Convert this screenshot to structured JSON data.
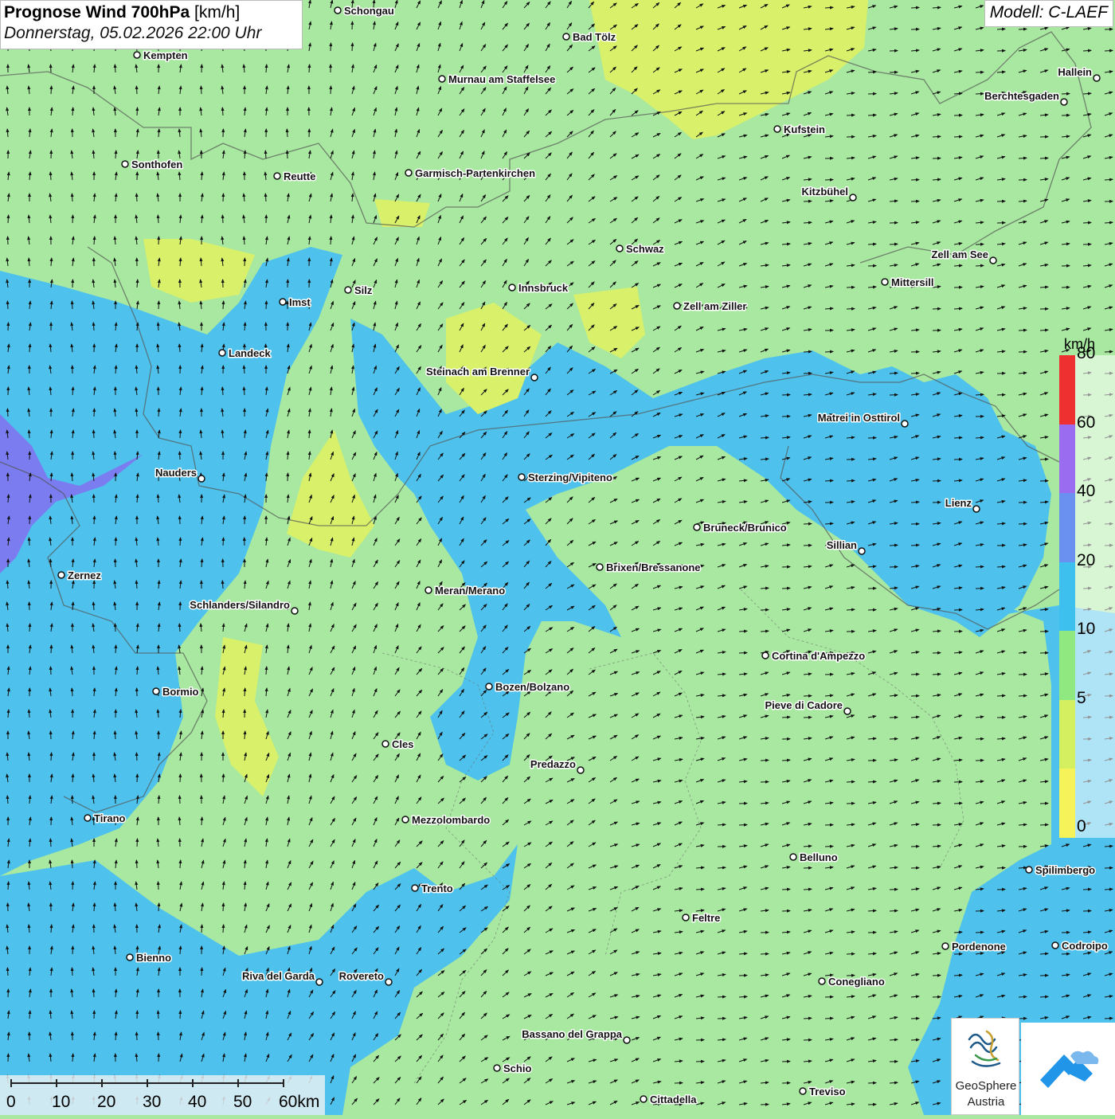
{
  "header": {
    "title_bold": "Prognose Wind 700hPa",
    "title_unit": "[km/h]",
    "datetime": "Donnerstag, 05.02.2026 22:00 Uhr",
    "model": "Modell: C-LAEF"
  },
  "legend": {
    "unit": "km/h",
    "classes": [
      {
        "label": "0",
        "color": "#f5f25a"
      },
      {
        "label": "5",
        "color": "#d4f060"
      },
      {
        "label": "10",
        "color": "#90e880"
      },
      {
        "label": "20",
        "color": "#3ec0ee"
      },
      {
        "label": "40",
        "color": "#6a90f0"
      },
      {
        "label": "60",
        "color": "#9a6cf0"
      },
      {
        "label": "80",
        "color": "#ee3030"
      }
    ]
  },
  "scale_bar": {
    "labels": [
      "0",
      "10",
      "20",
      "30",
      "40",
      "50",
      "60km"
    ]
  },
  "logos": {
    "geosphere_line1": "GeoSphere",
    "geosphere_line2": "Austria"
  },
  "cities": [
    {
      "name": "Schongau"
    },
    {
      "name": "Bad Tölz"
    },
    {
      "name": "Kempten"
    },
    {
      "name": "Murnau am Staffelsee"
    },
    {
      "name": "Hallein"
    },
    {
      "name": "Berchtesgaden"
    },
    {
      "name": "Kufstein"
    },
    {
      "name": "Sonthofen"
    },
    {
      "name": "Reutte"
    },
    {
      "name": "Garmisch-Partenkirchen"
    },
    {
      "name": "Kitzbühel"
    },
    {
      "name": "Schwaz"
    },
    {
      "name": "Zell am See"
    },
    {
      "name": "Mittersill"
    },
    {
      "name": "Innsbruck"
    },
    {
      "name": "Zell am Ziller"
    },
    {
      "name": "Silz"
    },
    {
      "name": "Imst"
    },
    {
      "name": "Landeck"
    },
    {
      "name": "Steinach am Brenner"
    },
    {
      "name": "Matrei in Osttirol"
    },
    {
      "name": "Nauders"
    },
    {
      "name": "Sterzing/Vipiteno"
    },
    {
      "name": "Lienz"
    },
    {
      "name": "Bruneck/Brunico"
    },
    {
      "name": "Sillian"
    },
    {
      "name": "Zernez"
    },
    {
      "name": "Brixen/Bressanone"
    },
    {
      "name": "Meran/Merano"
    },
    {
      "name": "Schlanders/Silandro"
    },
    {
      "name": "Cortina d'Ampezzo"
    },
    {
      "name": "Bormio"
    },
    {
      "name": "Bozen/Bolzano"
    },
    {
      "name": "Pieve di Cadore"
    },
    {
      "name": "Cles"
    },
    {
      "name": "Predazzo"
    },
    {
      "name": "Tirano"
    },
    {
      "name": "Mezzolombardo"
    },
    {
      "name": "Belluno"
    },
    {
      "name": "Spilimbergo"
    },
    {
      "name": "Trento"
    },
    {
      "name": "Feltre"
    },
    {
      "name": "Pordenone"
    },
    {
      "name": "Codroipo"
    },
    {
      "name": "Bienno"
    },
    {
      "name": "Riva del Garda"
    },
    {
      "name": "Rovereto"
    },
    {
      "name": "Conegliano"
    },
    {
      "name": "Bassano del Grappa"
    },
    {
      "name": "Schio"
    },
    {
      "name": "Treviso"
    },
    {
      "name": "Cittadella"
    }
  ]
}
